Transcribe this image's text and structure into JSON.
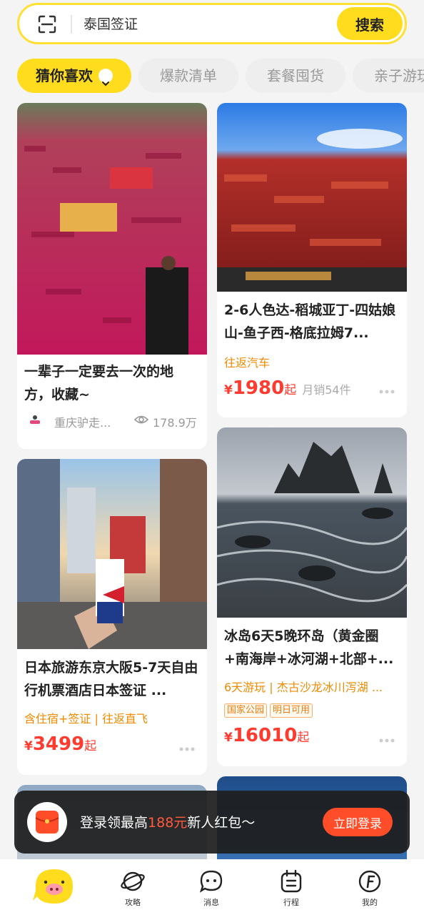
{
  "search": {
    "value": "泰国签证",
    "button_label": "搜索"
  },
  "tabs": [
    {
      "label": "猜你喜欢",
      "active": true
    },
    {
      "label": "爆款清单",
      "active": false
    },
    {
      "label": "套餐囤货",
      "active": false
    },
    {
      "label": "亲子游玩",
      "active": false
    }
  ],
  "cards": {
    "left1": {
      "title": "一辈子一定要去一次的地方，收藏~",
      "author": "重庆驴走...",
      "views": "178.9万"
    },
    "left2": {
      "title": "日本旅游东京大阪5-7天自由行机票酒店日本签证 ...",
      "tags": "含住宿+签证 | 往返直飞",
      "price_currency": "¥",
      "price": "3499",
      "price_suffix": "起"
    },
    "right1": {
      "title": "2-6人色达-稻城亚丁-四姑娘山-鱼子西-格底拉姆7...",
      "tags": "往返汽车",
      "price_currency": "¥",
      "price": "1980",
      "price_suffix": "起",
      "sales": "月销54件"
    },
    "right2": {
      "title": "冰岛6天5晚环岛（黄金圈+南海岸+冰河湖+北部+...",
      "tags": "6天游玩 | 杰古沙龙冰川泻湖 ...",
      "badges": [
        "国家公园",
        "明日可用"
      ],
      "price_currency": "¥",
      "price": "16010",
      "price_suffix": "起"
    }
  },
  "login_banner": {
    "text_before": "登录领最高",
    "highlight": "188元",
    "text_after": "新人红包～",
    "button_label": "立即登录"
  },
  "bottom_nav": {
    "items": [
      {
        "label": "",
        "icon": "home-mascot-icon"
      },
      {
        "label": "攻略",
        "icon": "planet-icon"
      },
      {
        "label": "消息",
        "icon": "message-icon"
      },
      {
        "label": "行程",
        "icon": "itinerary-icon"
      },
      {
        "label": "我的",
        "icon": "profile-icon"
      }
    ]
  },
  "colors": {
    "accent": "#ffdd1e",
    "price": "#ff3a2f",
    "tag": "#f08a00"
  }
}
